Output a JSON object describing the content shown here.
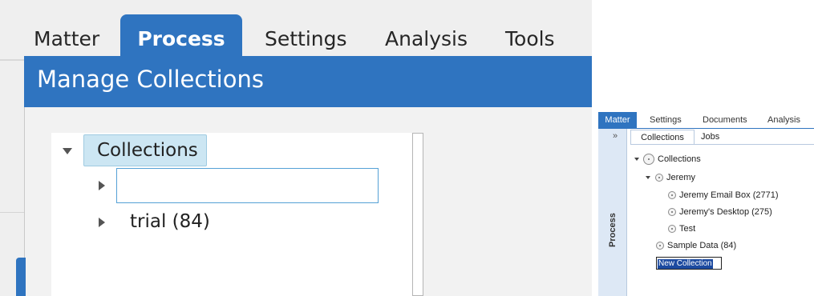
{
  "left": {
    "tabs": [
      {
        "label": "Matter"
      },
      {
        "label": "Process"
      },
      {
        "label": "Settings"
      },
      {
        "label": "Analysis"
      },
      {
        "label": "Tools"
      }
    ],
    "active_tab": "Process",
    "panel_title": "Manage Collections",
    "tree": {
      "root_label": "Collections",
      "new_item_value": "",
      "items": [
        {
          "label": "trial (84)"
        }
      ]
    }
  },
  "right": {
    "tabs": [
      {
        "label": "Matter"
      },
      {
        "label": "Settings"
      },
      {
        "label": "Documents"
      },
      {
        "label": "Analysis"
      }
    ],
    "active_tab": "Matter",
    "collapse_glyph": "»",
    "side_label": "Process",
    "subtabs": [
      {
        "label": "Collections"
      },
      {
        "label": "Jobs"
      }
    ],
    "tree": {
      "root_label": "Collections",
      "group_label": "Jeremy",
      "group_items": [
        {
          "label": "Jeremy Email Box (2771)"
        },
        {
          "label": "Jeremy's Desktop (275)"
        },
        {
          "label": "Test"
        }
      ],
      "sample_label": "Sample Data (84)",
      "new_collection_value": "New Collection"
    }
  },
  "colors": {
    "accent_blue": "#2f74c0",
    "selection_bg": "#cce6f3",
    "input_border": "#55a1d6"
  }
}
